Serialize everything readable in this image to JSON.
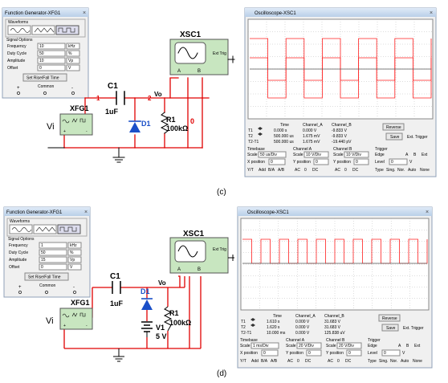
{
  "panels": [
    {
      "caption": "(c)",
      "fg": {
        "title": "Function Generator-XFG1",
        "waveforms_label": "Waveforms",
        "signal_options_label": "Signal Options",
        "rows": [
          {
            "label": "Frequency",
            "value": "10",
            "unit": "kHz"
          },
          {
            "label": "Duty Cycle",
            "value": "50",
            "unit": "%"
          },
          {
            "label": "Amplitude",
            "value": "10",
            "unit": "Vp"
          },
          {
            "label": "Offset",
            "value": "0",
            "unit": "V"
          }
        ],
        "set_rise_label": "Set Rise/Fall Time",
        "common_label": "Common",
        "plus": "+",
        "minus": "-"
      },
      "circuit": {
        "xsc_label": "XSC1",
        "ext_trig": "Ext Trig",
        "xfg_label": "XFG1",
        "vi_label": "Vi",
        "c1_label": "C1",
        "c1_value": "1uF",
        "d1_label": "D1",
        "r1_label": "R1",
        "r1_value": "100kΩ",
        "vo_label": "Vo",
        "node1": "1",
        "node2": "2",
        "node0": "0",
        "has_battery": false,
        "ch_a": "A",
        "ch_b": "B"
      },
      "osc": {
        "title": "Oscilloscope-XSC1",
        "readout_headers": [
          "Time",
          "Channel_A",
          "Channel_B"
        ],
        "readout_rows": [
          {
            "label": "T1",
            "time": "0.000 s",
            "a": "0.000 V",
            "b": "-9.833 V"
          },
          {
            "label": "T2",
            "time": "500.000 us",
            "a": "1.675 mV",
            "b": "-9.833 V"
          },
          {
            "label": "T2-T1",
            "time": "500.000 us",
            "a": "1.675 mV",
            "b": "-19.440 pV"
          }
        ],
        "reverse": "Reverse",
        "save": "Save",
        "ext_trigger": "Ext. Trigger",
        "timebase": {
          "label": "Timebase",
          "scale": "50 us/Div",
          "xpos": "0",
          "buttons": [
            "Y/T",
            "Add",
            "B/A",
            "A/B"
          ]
        },
        "channel_a": {
          "label": "Channel A",
          "scale": "10 V/Div",
          "ypos": "0",
          "buttons": [
            "AC",
            "0",
            "DC"
          ]
        },
        "channel_b": {
          "label": "Channel B",
          "scale": "10 V/Div",
          "ypos": "0",
          "buttons": [
            "AC",
            "0",
            "DC"
          ]
        },
        "trigger": {
          "label": "Trigger",
          "edge": "Edge",
          "level": "0",
          "level_unit": "V",
          "type": "Type",
          "buttons": [
            "Sing.",
            "Nor.",
            "Auto",
            "None"
          ],
          "src": [
            "A",
            "B",
            "Ext"
          ]
        }
      }
    },
    {
      "caption": "(d)",
      "fg": {
        "title": "Function Generator-XFG1",
        "waveforms_label": "Waveforms",
        "signal_options_label": "Signal Options",
        "rows": [
          {
            "label": "Frequency",
            "value": "1",
            "unit": "kHz"
          },
          {
            "label": "Duty Cycle",
            "value": "50",
            "unit": "%"
          },
          {
            "label": "Amplitude",
            "value": "15",
            "unit": "Vp"
          },
          {
            "label": "Offset",
            "value": "0",
            "unit": "V"
          }
        ],
        "set_rise_label": "Set Rise/Fall Time",
        "common_label": "Common",
        "plus": "+",
        "minus": "-"
      },
      "circuit": {
        "xsc_label": "XSC1",
        "ext_trig": "Ext Trig",
        "xfg_label": "XFG1",
        "vi_label": "Vi",
        "c1_label": "C1",
        "c1_value": "1uF",
        "d1_label": "D1",
        "r1_label": "R1",
        "r1_value": "100kΩ",
        "vo_label": "Vo",
        "v1_label": "V1",
        "v1_value": "5 V",
        "has_battery": true,
        "ch_a": "A",
        "ch_b": "B"
      },
      "osc": {
        "title": "Oscilloscope-XSC1",
        "readout_headers": [
          "Time",
          "Channel_A",
          "Channel_B"
        ],
        "readout_rows": [
          {
            "label": "T1",
            "time": "1.610 s",
            "a": "0.000 V",
            "b": "31.683 V"
          },
          {
            "label": "T2",
            "time": "1.620 s",
            "a": "0.000 V",
            "b": "31.683 V"
          },
          {
            "label": "T2-T1",
            "time": "10.000 ms",
            "a": "0.000 V",
            "b": "125.838 uV"
          }
        ],
        "reverse": "Reverse",
        "save": "Save",
        "ext_trigger": "Ext. Trigger",
        "timebase": {
          "label": "Timebase",
          "scale": "1 ms/Div",
          "xpos": "0",
          "buttons": [
            "Y/T",
            "Add",
            "B/A",
            "A/B"
          ]
        },
        "channel_a": {
          "label": "Channel A",
          "scale": "20 V/Div",
          "ypos": "0",
          "buttons": [
            "AC",
            "0",
            "DC"
          ]
        },
        "channel_b": {
          "label": "Channel B",
          "scale": "20 V/Div",
          "ypos": "0",
          "buttons": [
            "AC",
            "0",
            "DC"
          ]
        },
        "trigger": {
          "label": "Trigger",
          "edge": "Edge",
          "level": "0",
          "level_unit": "V",
          "type": "Type",
          "buttons": [
            "Sing.",
            "Nor.",
            "Auto",
            "None"
          ],
          "src": [
            "A",
            "B",
            "Ext"
          ]
        }
      }
    }
  ],
  "colors": {
    "wire": "#e00000",
    "diode": "#1a4fc8",
    "trace": "#ff2020",
    "instrument": "#c8e6c0"
  }
}
